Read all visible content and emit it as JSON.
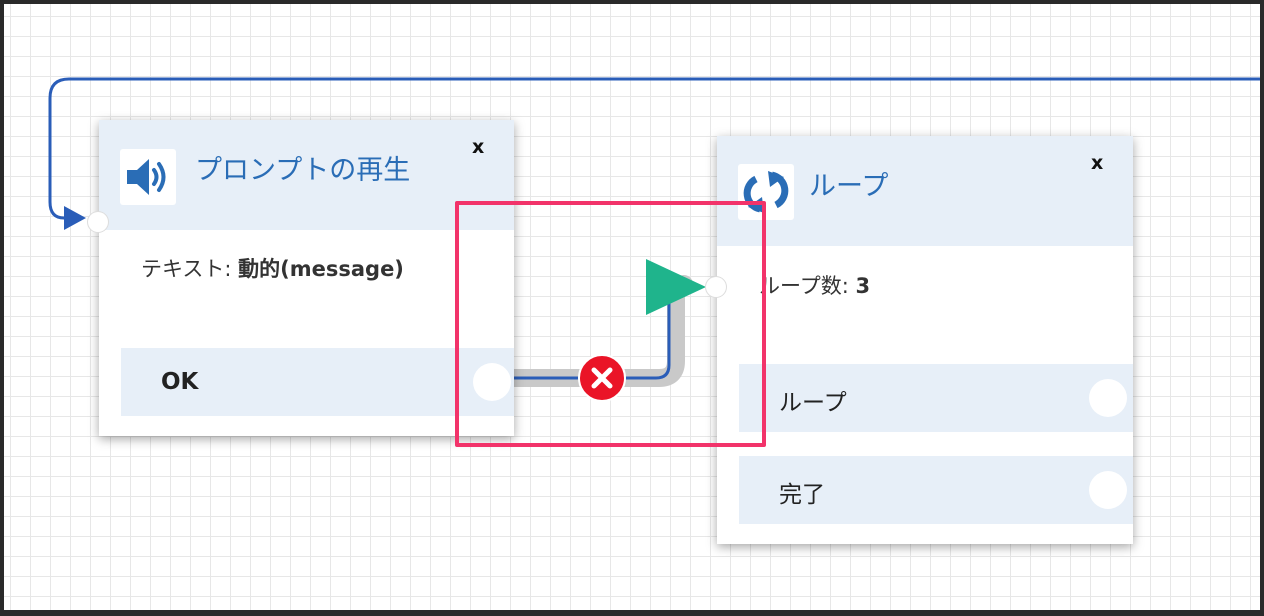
{
  "prompt_block": {
    "title": "プロンプトの再生",
    "close_label": "x",
    "info_label": "テキスト:",
    "info_value": "動的(message)",
    "ports": [
      {
        "label": "OK"
      }
    ]
  },
  "loop_block": {
    "title": "ループ",
    "close_label": "x",
    "info_label": "ループ数:",
    "info_value": "3",
    "ports": [
      {
        "label": "ループ"
      },
      {
        "label": "完了"
      }
    ]
  },
  "colors": {
    "wire": "#2a5db8",
    "wire_shadow": "#c9c9c9",
    "highlight": "#f2336a",
    "delete_button": "#ea1427",
    "arrow_head": "#1fb48c",
    "header_bg": "#e7eff8",
    "title_text": "#2a6db6"
  },
  "icons": {
    "prompt": "speaker-icon",
    "loop": "loop-arrows-icon",
    "delete": "delete-x-icon"
  }
}
